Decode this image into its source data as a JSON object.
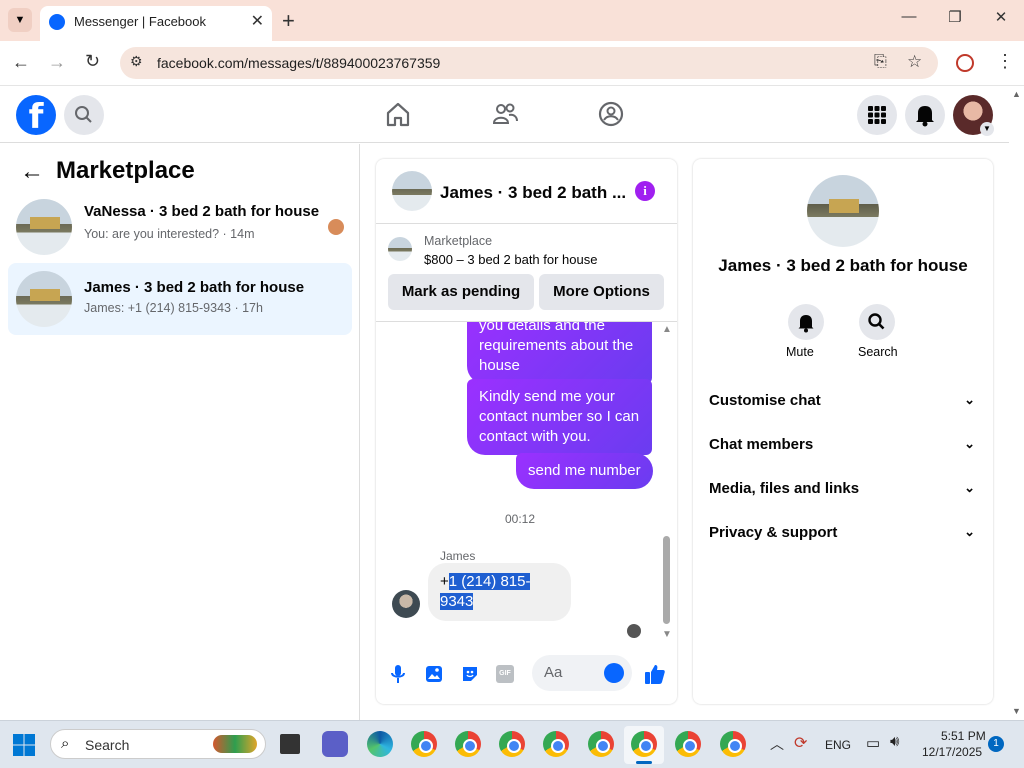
{
  "browser": {
    "tab_title": "Messenger | Facebook",
    "url": "facebook.com/messages/t/889400023767359"
  },
  "left_panel": {
    "title": "Marketplace",
    "conversations": [
      {
        "name": "VaNessa · 3 bed 2 bath for house",
        "preview": "You: are you interested? · 14m"
      },
      {
        "name": "James · 3 bed 2 bath for house",
        "preview": "James: +1 (214) 815-9343 · 17h"
      }
    ]
  },
  "chat": {
    "header_title": "James · 3 bed 2 bath ...",
    "listing_source": "Marketplace",
    "listing_detail": "$800 – 3 bed 2 bath for house",
    "mark_pending_label": "Mark as pending",
    "more_options_label": "More Options",
    "messages": [
      {
        "text": "you details and the requirements about the house"
      },
      {
        "text": "Kindly send me your contact number so I can contact with you."
      },
      {
        "text": "send me number"
      }
    ],
    "timestamp": "00:12",
    "incoming_sender": "James",
    "incoming_prefix": "+",
    "incoming_selected": "1 (214) 815-9343",
    "composer_placeholder": "Aa"
  },
  "right_panel": {
    "title": "James · 3 bed 2 bath for house",
    "mute_label": "Mute",
    "search_label": "Search",
    "sections": [
      "Customise chat",
      "Chat members",
      "Media, files and links",
      "Privacy & support"
    ]
  },
  "taskbar": {
    "search_label": "Search",
    "lang": "ENG",
    "time": "5:51 PM",
    "date": "12/17/2025",
    "notification_count": "1"
  },
  "colors": {
    "fb_blue": "#0866ff",
    "bubble_purple": "#8a2be2",
    "selected_conv_bg": "#ebf5ff"
  }
}
